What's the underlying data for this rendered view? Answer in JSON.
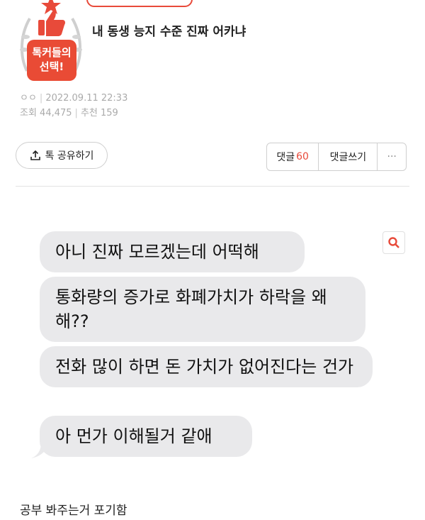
{
  "header": {
    "top_pill": "",
    "badge_line1": "톡커들의",
    "badge_line2": "선택!",
    "title": "내 동생 능지 수준 진짜 어카냐"
  },
  "meta": {
    "author": "ㅇㅇ",
    "date": "2022.09.11 22:33",
    "views": "조회 44,475",
    "recommends": "추천 159"
  },
  "actions": {
    "share_label": "톡 공유하기",
    "comments_label": "댓글",
    "comments_count": "60",
    "write_comment_label": "댓글쓰기",
    "more_label": "···"
  },
  "chat": {
    "messages": [
      "아니 진짜 모르겠는데 어떡해",
      "통화량의 증가로 화폐가치가 하락을 왜 해??",
      "전화 많이 하면 돈 가치가 없어진다는 건가",
      "아 먼가 이해될거 같애"
    ]
  },
  "footer": {
    "caption": "공부 봐주는거 포기함"
  },
  "colors": {
    "accent": "#e84a3a",
    "bubble": "#e9e9eb"
  }
}
